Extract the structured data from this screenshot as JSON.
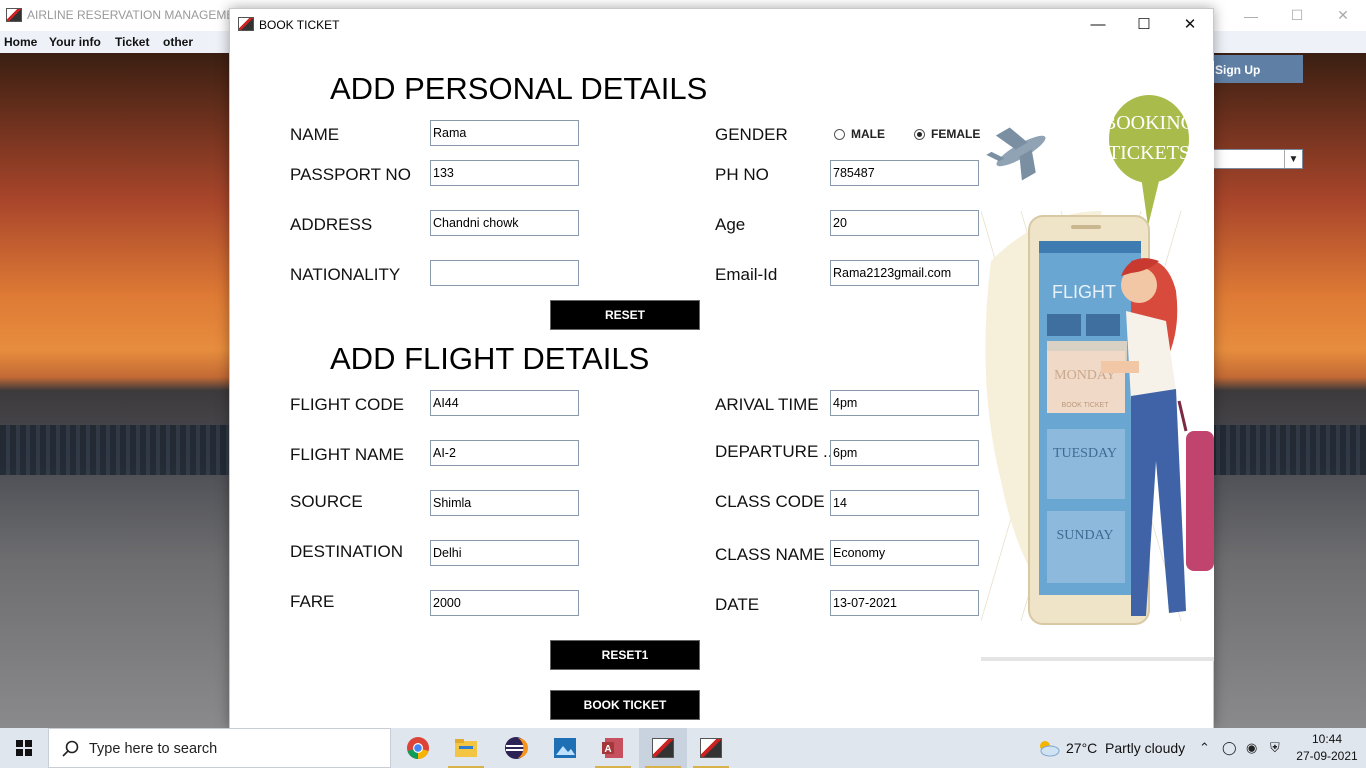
{
  "background_app": {
    "title": "AIRLINE RESERVATION MANAGEMENT",
    "menu": [
      "Home",
      "Your info",
      "Ticket",
      "other"
    ],
    "signup_label": "Sign Up"
  },
  "dialog": {
    "title": "BOOK TICKET",
    "personal": {
      "heading": "ADD PERSONAL DETAILS",
      "name_label": "NAME",
      "name_value": "Rama",
      "passport_label": "PASSPORT NO",
      "passport_value": "133",
      "address_label": "ADDRESS",
      "address_value": "Chandni chowk",
      "nationality_label": "NATIONALITY",
      "nationality_value": "",
      "gender_label": "GENDER",
      "gender_male": "MALE",
      "gender_female": "FEMALE",
      "gender_selected": "FEMALE",
      "phone_label": "PH NO",
      "phone_value": "785487",
      "age_label": "Age",
      "age_value": "20",
      "email_label": "Email-Id",
      "email_value": "Rama2123gmail.com",
      "reset_label": "RESET"
    },
    "flight": {
      "heading": "ADD FLIGHT DETAILS",
      "code_label": "FLIGHT CODE",
      "code_value": "AI44",
      "name_label": "FLIGHT NAME",
      "name_value": "AI-2",
      "source_label": "SOURCE",
      "source_value": "Shimla",
      "destination_label": "DESTINATION",
      "destination_value": "Delhi",
      "fare_label": "FARE",
      "fare_value": "2000",
      "arrival_label": "ARIVAL TIME",
      "arrival_value": "4pm",
      "departure_label": "DEPARTURE ...",
      "departure_value": "6pm",
      "class_code_label": "CLASS CODE",
      "class_code_value": "14",
      "class_name_label": "CLASS NAME",
      "class_name_value": "Economy",
      "date_label": "DATE",
      "date_value": "13-07-2021",
      "reset_label": "RESET1",
      "book_label": "BOOK TICKET"
    },
    "illustration": {
      "bubble_line1": "BOOKING",
      "bubble_line2": "TICKETS",
      "screen_title": "FLIGHT",
      "day1": "MONDAY",
      "day2": "TUESDAY",
      "day3": "SUNDAY",
      "book_ticket_small": "BOOK TICKET"
    }
  },
  "taskbar": {
    "search_placeholder": "Type here to search",
    "weather_temp": "27°C",
    "weather_desc": "Partly cloudy",
    "time": "10:44",
    "date": "27-09-2021"
  },
  "colors": {
    "button_bg": "#000000",
    "signup_bg": "#5f7fa5",
    "field_border": "#8a9aad"
  }
}
